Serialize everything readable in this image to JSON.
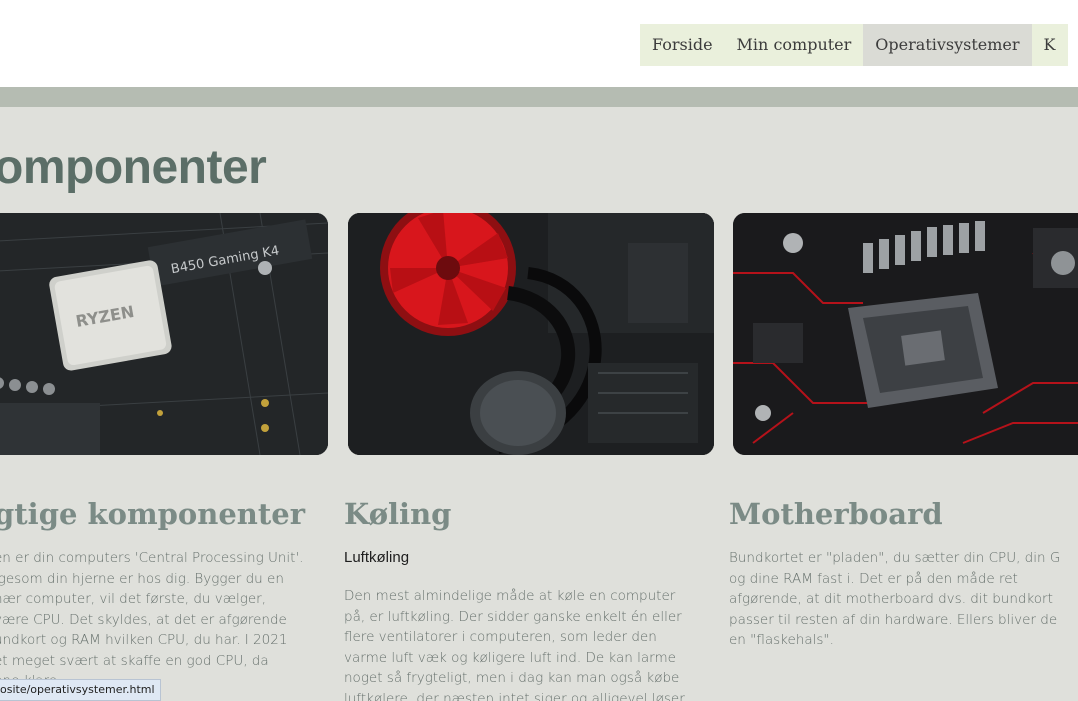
{
  "nav": {
    "items": [
      {
        "label": "Forside"
      },
      {
        "label": "Min computer"
      },
      {
        "label": "Operativsystemer"
      },
      {
        "label": "K"
      }
    ]
  },
  "page": {
    "title": "omponenter"
  },
  "cards": [
    {
      "heading": "gtige komponenter",
      "lines": [
        "en er din computers 'Central Processing Unit'.",
        "igesom din hjerne er hos dig. Bygger du en",
        "nær computer, vil det første, du vælger,",
        " være CPU. Det skyldes, at det er afgørende",
        "undkort og RAM hvilken CPU, du har. I 2021",
        "et meget svært at skaffe en god CPU, da",
        "                     nne klare"
      ]
    },
    {
      "heading": "Køling",
      "subheading": "Luftkøling",
      "lines": [
        "Den mest almindelige måde at køle en computer",
        "på, er luftkøling. Der sidder ganske enkelt én eller",
        "flere ventilatorer i computeren, som leder den",
        "varme luft væk og køligere luft ind. De kan larme",
        "noget så frygteligt, men i dag kan man også købe",
        "luftkølere, der næsten intet siger og alligevel løser"
      ]
    },
    {
      "heading": "Motherboard",
      "lines": [
        "Bundkortet er \"pladen\", du sætter din CPU, din G",
        "og dine RAM fast i. Det er på den måde ret",
        "afgørende, at dit motherboard dvs. dit bundkort",
        "passer til resten af din hardware. Ellers bliver de",
        "en \"flaskehals\"."
      ]
    }
  ],
  "images": {
    "card1_print": "RYZEN",
    "card1_board_print": "B450 Gaming K4"
  },
  "status": {
    "url": "osite/operativsystemer.html"
  },
  "colors": {
    "nav_bg": "#eaf0dc",
    "nav_active_bg": "#dadbd5",
    "stripe": "#b5bcb2",
    "main_bg": "#dfe0db",
    "title": "#5b6e67",
    "heading": "#7b8b86",
    "fan_red": "#d8161c"
  }
}
